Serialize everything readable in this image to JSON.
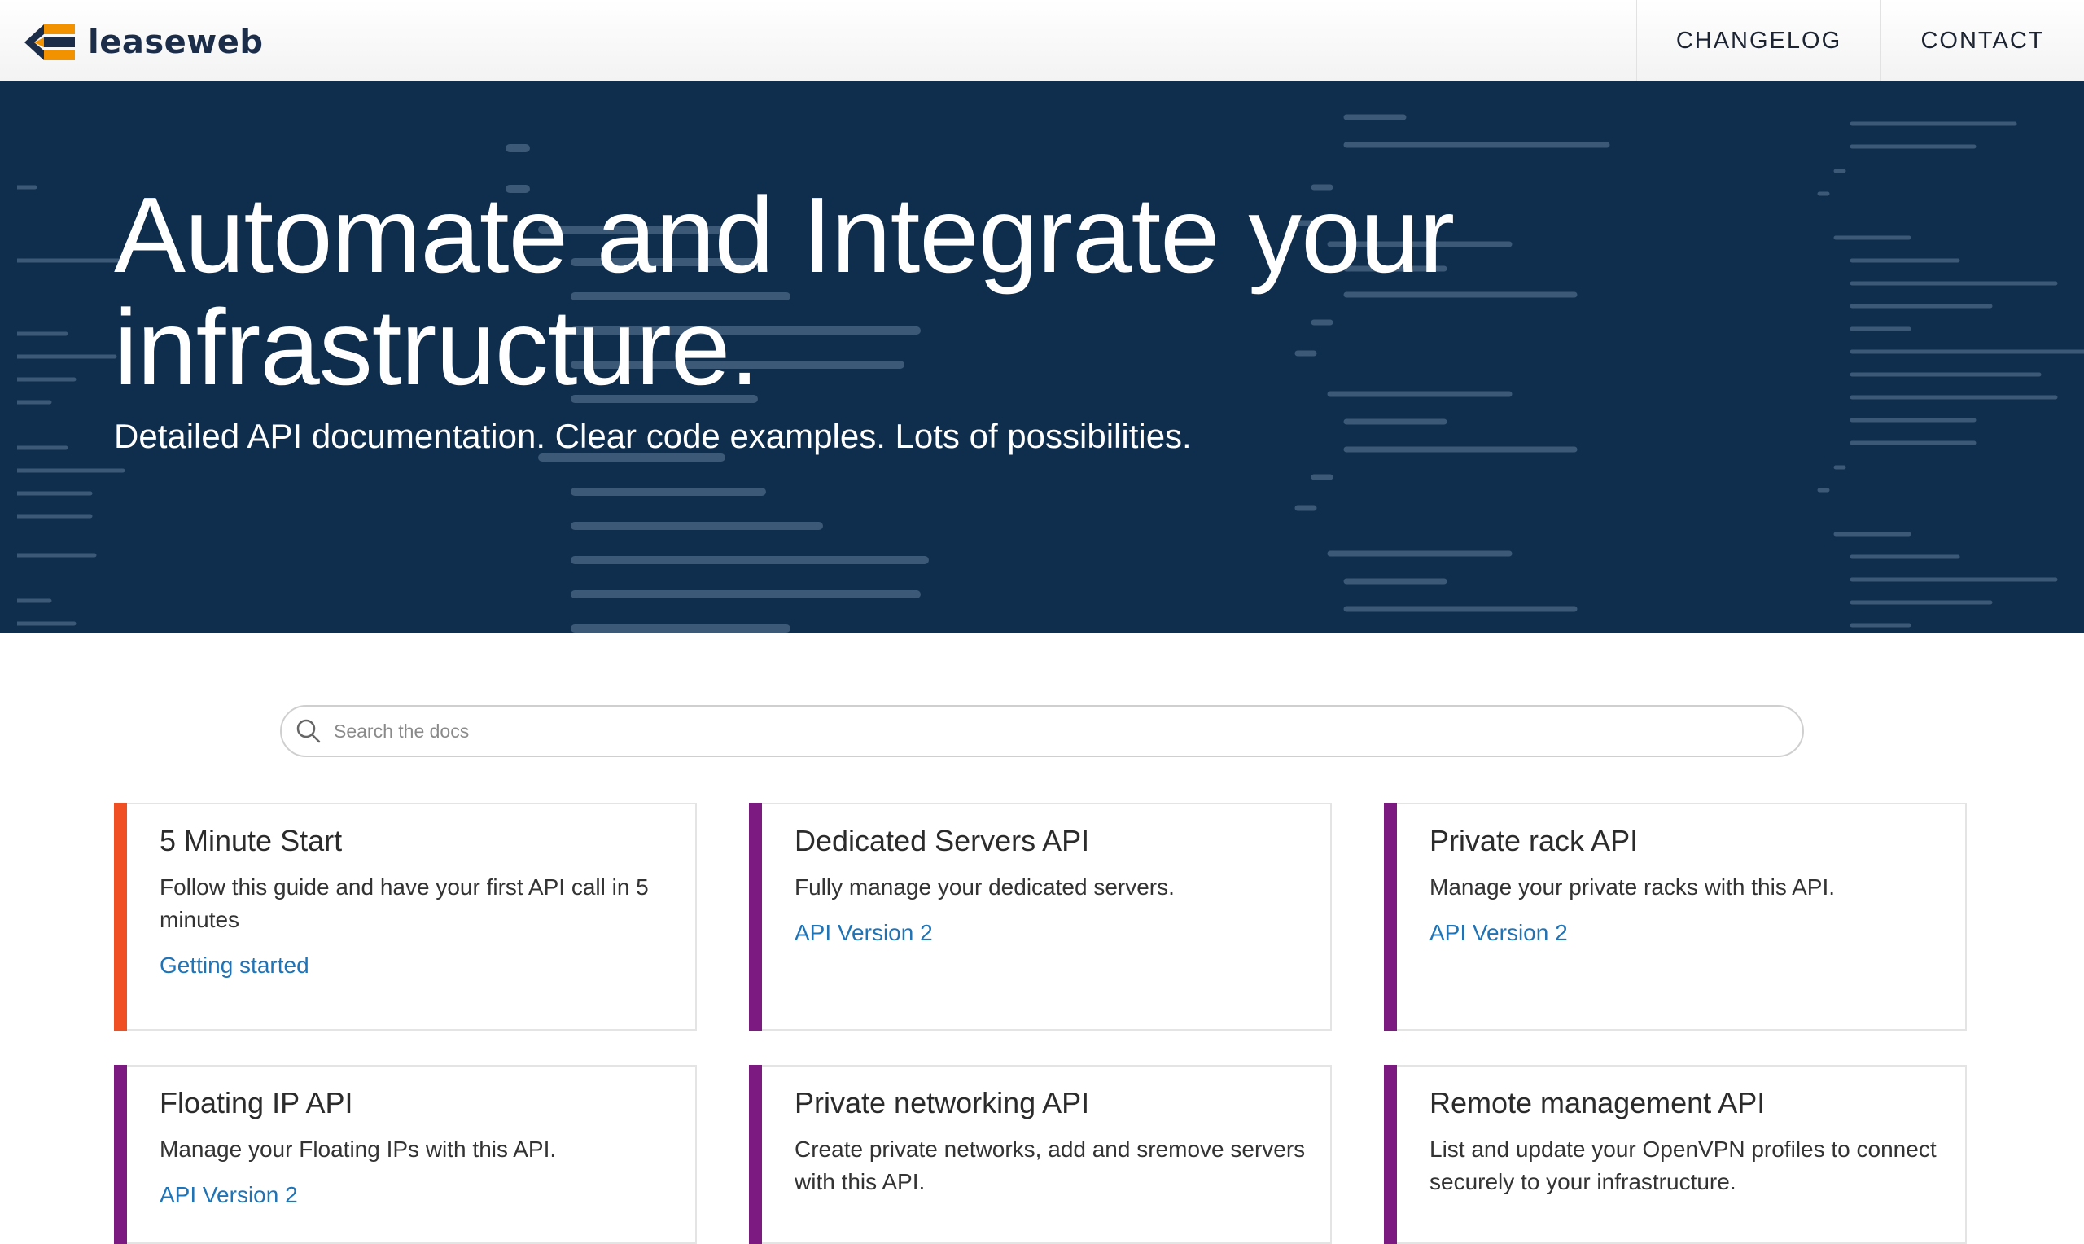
{
  "header": {
    "logo_text": "leaseweb",
    "nav": [
      {
        "label": "CHANGELOG"
      },
      {
        "label": "CONTACT"
      }
    ]
  },
  "hero": {
    "title": "Automate and Integrate your infrastructure.",
    "subtitle": "Detailed API documentation. Clear code examples. Lots of possibilities."
  },
  "search": {
    "placeholder": "Search the docs",
    "value": ""
  },
  "cards": [
    {
      "title": "5 Minute Start",
      "description": "Follow this guide and have your first API call in 5 minutes",
      "link": "Getting started",
      "accent": "#f04e23"
    },
    {
      "title": "Dedicated Servers API",
      "description": "Fully manage your dedicated servers.",
      "link": "API Version 2",
      "accent": "#7d1a82"
    },
    {
      "title": "Private rack API",
      "description": "Manage your private racks with this API.",
      "link": "API Version 2",
      "accent": "#7d1a82"
    },
    {
      "title": "Floating IP API",
      "description": "Manage your Floating IPs with this API.",
      "link": "API Version 2",
      "accent": "#7d1a82"
    },
    {
      "title": "Private networking API",
      "description": "Create private networks, add and sremove servers with this API.",
      "link": "",
      "accent": "#7d1a82"
    },
    {
      "title": "Remote management API",
      "description": "List and update your OpenVPN profiles to connect securely to your infrastructure.",
      "link": "",
      "accent": "#7d1a82"
    }
  ],
  "colors": {
    "hero_bg": "#0f2d4d",
    "link": "#1f73b7",
    "accent_orange": "#f04e23",
    "accent_purple": "#7d1a82",
    "logo_orange": "#f39200",
    "logo_navy": "#1c2d4a"
  },
  "icons": {
    "logo": "leaseweb-logo-icon",
    "search": "search-icon"
  }
}
